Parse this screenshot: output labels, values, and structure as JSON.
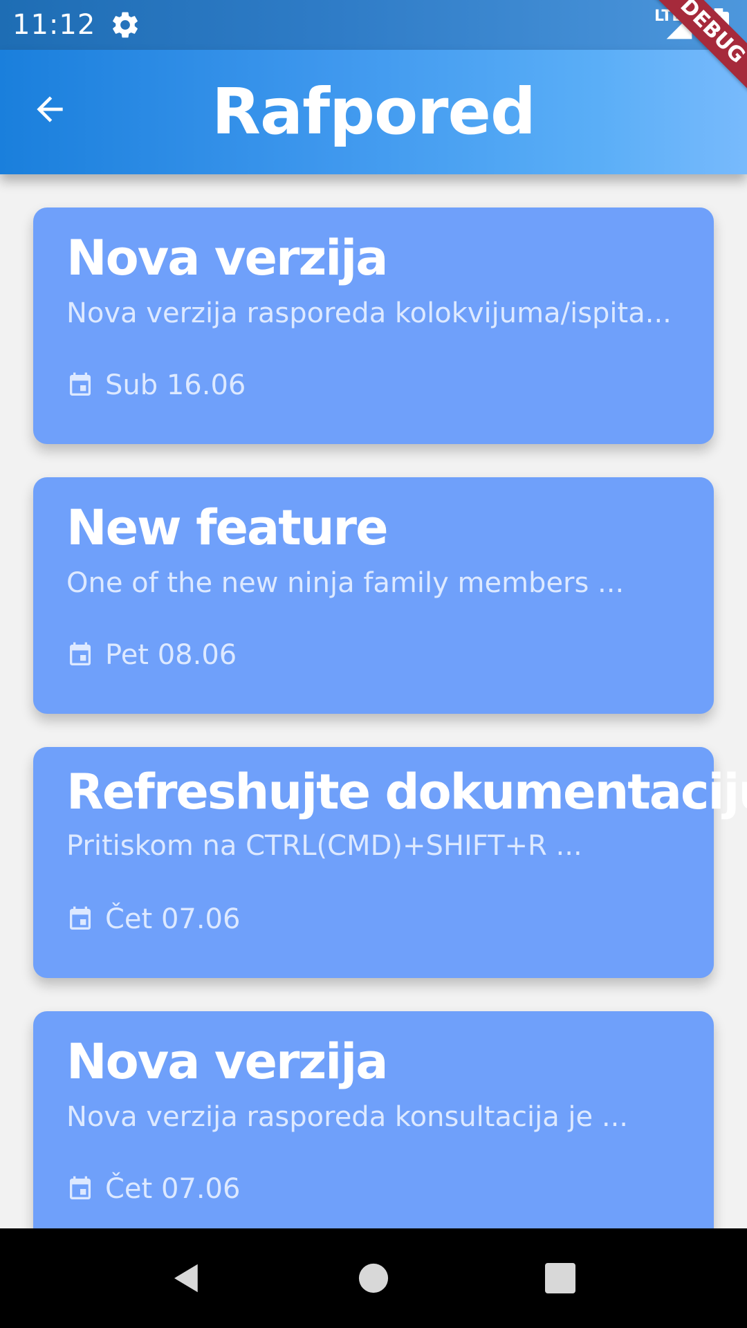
{
  "status_bar": {
    "time": "11:12",
    "network": "LTE",
    "icons": [
      "settings-gear-icon",
      "signal-icon",
      "battery-charging-icon"
    ]
  },
  "debug_banner": "DEBUG",
  "app_bar": {
    "title": "Rafpored",
    "back_icon": "arrow-back-icon"
  },
  "colors": {
    "app_bar_gradient_start": "#1a7fdc",
    "app_bar_gradient_end": "#78bafc",
    "card_background": "#6fa0fa",
    "card_secondary_text": "#dde9ff",
    "debug_banner": "#a62a3b"
  },
  "notices": [
    {
      "title": "Nova verzija",
      "description": "Nova verzija rasporeda kolokvijuma/ispita...",
      "date": "Sub 16.06",
      "icon": "calendar-icon"
    },
    {
      "title": "New feature",
      "description": "One of the new ninja family members ...",
      "date": "Pet 08.06",
      "icon": "calendar-icon"
    },
    {
      "title": "Refreshujte dokumentaciju",
      "description": "Pritiskom na CTRL(CMD)+SHIFT+R ...",
      "date": "Čet 07.06",
      "icon": "calendar-icon"
    },
    {
      "title": "Nova verzija",
      "description": "Nova verzija rasporeda konsultacija je ...",
      "date": "Čet 07.06",
      "icon": "calendar-icon"
    }
  ],
  "nav_bar": {
    "buttons": [
      "nav-back-icon",
      "nav-home-icon",
      "nav-recents-icon"
    ]
  }
}
